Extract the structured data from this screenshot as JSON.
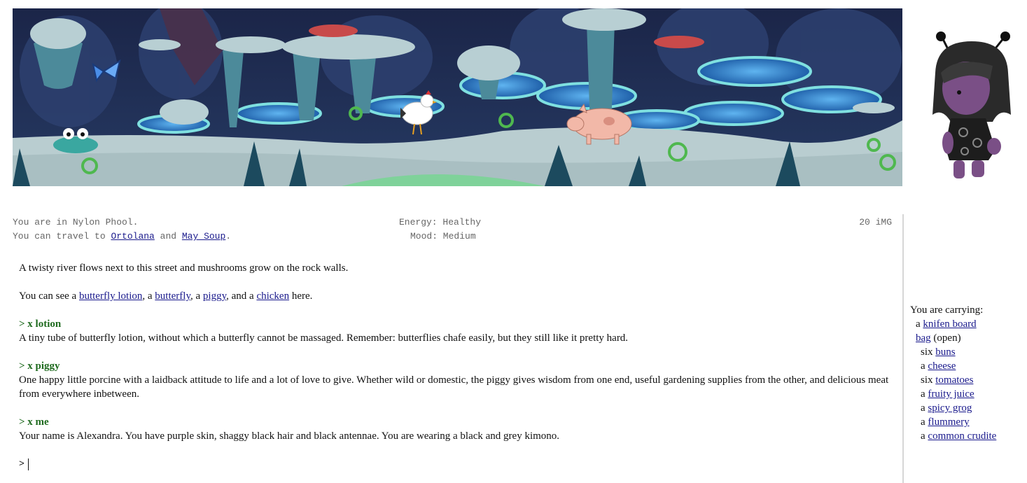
{
  "status": {
    "location_prefix": "You are in ",
    "location": "Nylon Phool",
    "location_suffix": ".",
    "travel_prefix": "You can travel to ",
    "travel_dest_1": "Ortolana",
    "travel_join": " and ",
    "travel_dest_2": "May Soup",
    "travel_suffix": ".",
    "energy": "Energy: Healthy",
    "mood": "Mood: Medium",
    "money": "20 iMG"
  },
  "transcript": {
    "room_desc": "A twisty river flows next to this street and mushrooms grow on the rock walls.",
    "see_prefix": "You can see a ",
    "see_item_1": "butterfly lotion",
    "see_sep_1": ", a ",
    "see_item_2": "butterfly",
    "see_sep_2": ", a ",
    "see_item_3": "piggy",
    "see_sep_3": ", and a ",
    "see_item_4": "chicken",
    "see_suffix": " here.",
    "entries": [
      {
        "command": "> x lotion",
        "response": "A tiny tube of butterfly lotion, without which a butterfly cannot be massaged. Remember: butterflies chafe easily, but they still like it pretty hard."
      },
      {
        "command": "> x piggy",
        "response": "One happy little porcine with a laidback attitude to life and a lot of love to give. Whether wild or domestic, the piggy gives wisdom from one end, useful gardening supplies from the other, and delicious meat from everywhere inbetween."
      },
      {
        "command": "> x me",
        "response": "Your name is Alexandra. You have purple skin, shaggy black hair and black antennae. You are wearing a black and grey kimono."
      }
    ],
    "prompt": ">"
  },
  "inventory": {
    "heading": "You are carrying:",
    "items": [
      {
        "article": "a ",
        "name": "knifen board",
        "suffix": ""
      },
      {
        "article": "",
        "name": "bag",
        "suffix": " (open)"
      },
      {
        "article": "six ",
        "name": "buns",
        "suffix": ""
      },
      {
        "article": "a ",
        "name": "cheese",
        "suffix": ""
      },
      {
        "article": "six ",
        "name": "tomatoes",
        "suffix": ""
      },
      {
        "article": "a ",
        "name": "fruity juice",
        "suffix": ""
      },
      {
        "article": "a ",
        "name": "spicy grog",
        "suffix": ""
      },
      {
        "article": "a ",
        "name": "flummery",
        "suffix": ""
      },
      {
        "article": "a ",
        "name": "common crudite",
        "suffix": ""
      }
    ]
  },
  "colors": {
    "link": "#1a1a8c",
    "command": "#1f6b1f",
    "status_text": "#666666",
    "scene_sky": "#1b2a4a",
    "scene_path": "#b9cdd0",
    "avatar_skin": "#7a4f86"
  },
  "scene": {
    "characters": [
      "butterfly",
      "chicken",
      "piggy",
      "skull-clam"
    ],
    "avatar": "purple-alien-kimono"
  }
}
